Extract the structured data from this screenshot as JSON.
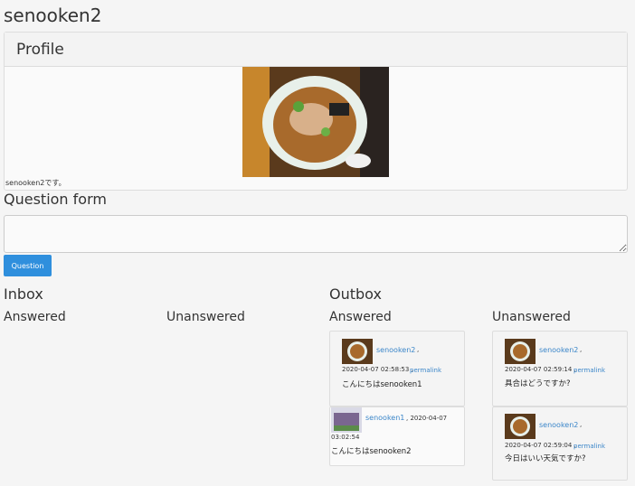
{
  "page": {
    "title": "senooken2"
  },
  "profile": {
    "heading": "Profile",
    "description": "senooken2です。"
  },
  "question_form": {
    "title": "Question form",
    "textarea_value": "",
    "button_label": "Question"
  },
  "inbox": {
    "title": "Inbox",
    "answered_label": "Answered",
    "unanswered_label": "Unanswered"
  },
  "outbox": {
    "title": "Outbox",
    "answered_label": "Answered",
    "unanswered_label": "Unanswered",
    "answered": [
      {
        "user": "senooken2",
        "sep": ",",
        "datetime": "2020-04-07 02:58:53 ,",
        "permalink": "permalink",
        "message": "こんにちはsenooken1"
      },
      {
        "user": "senooken1",
        "sep": ", 2020-04-07",
        "datetime": "03:02:54",
        "message": "こんにちはsenooken2"
      }
    ],
    "unanswered": [
      {
        "user": "senooken2",
        "sep": ",",
        "datetime": "2020-04-07 02:59:14 ,",
        "permalink": "permalink",
        "message": "具合はどうですか?"
      },
      {
        "user": "senooken2",
        "sep": ",",
        "datetime": "2020-04-07 02:59:04 ,",
        "permalink": "permalink",
        "message": "今日はいい天気ですか?"
      }
    ]
  }
}
